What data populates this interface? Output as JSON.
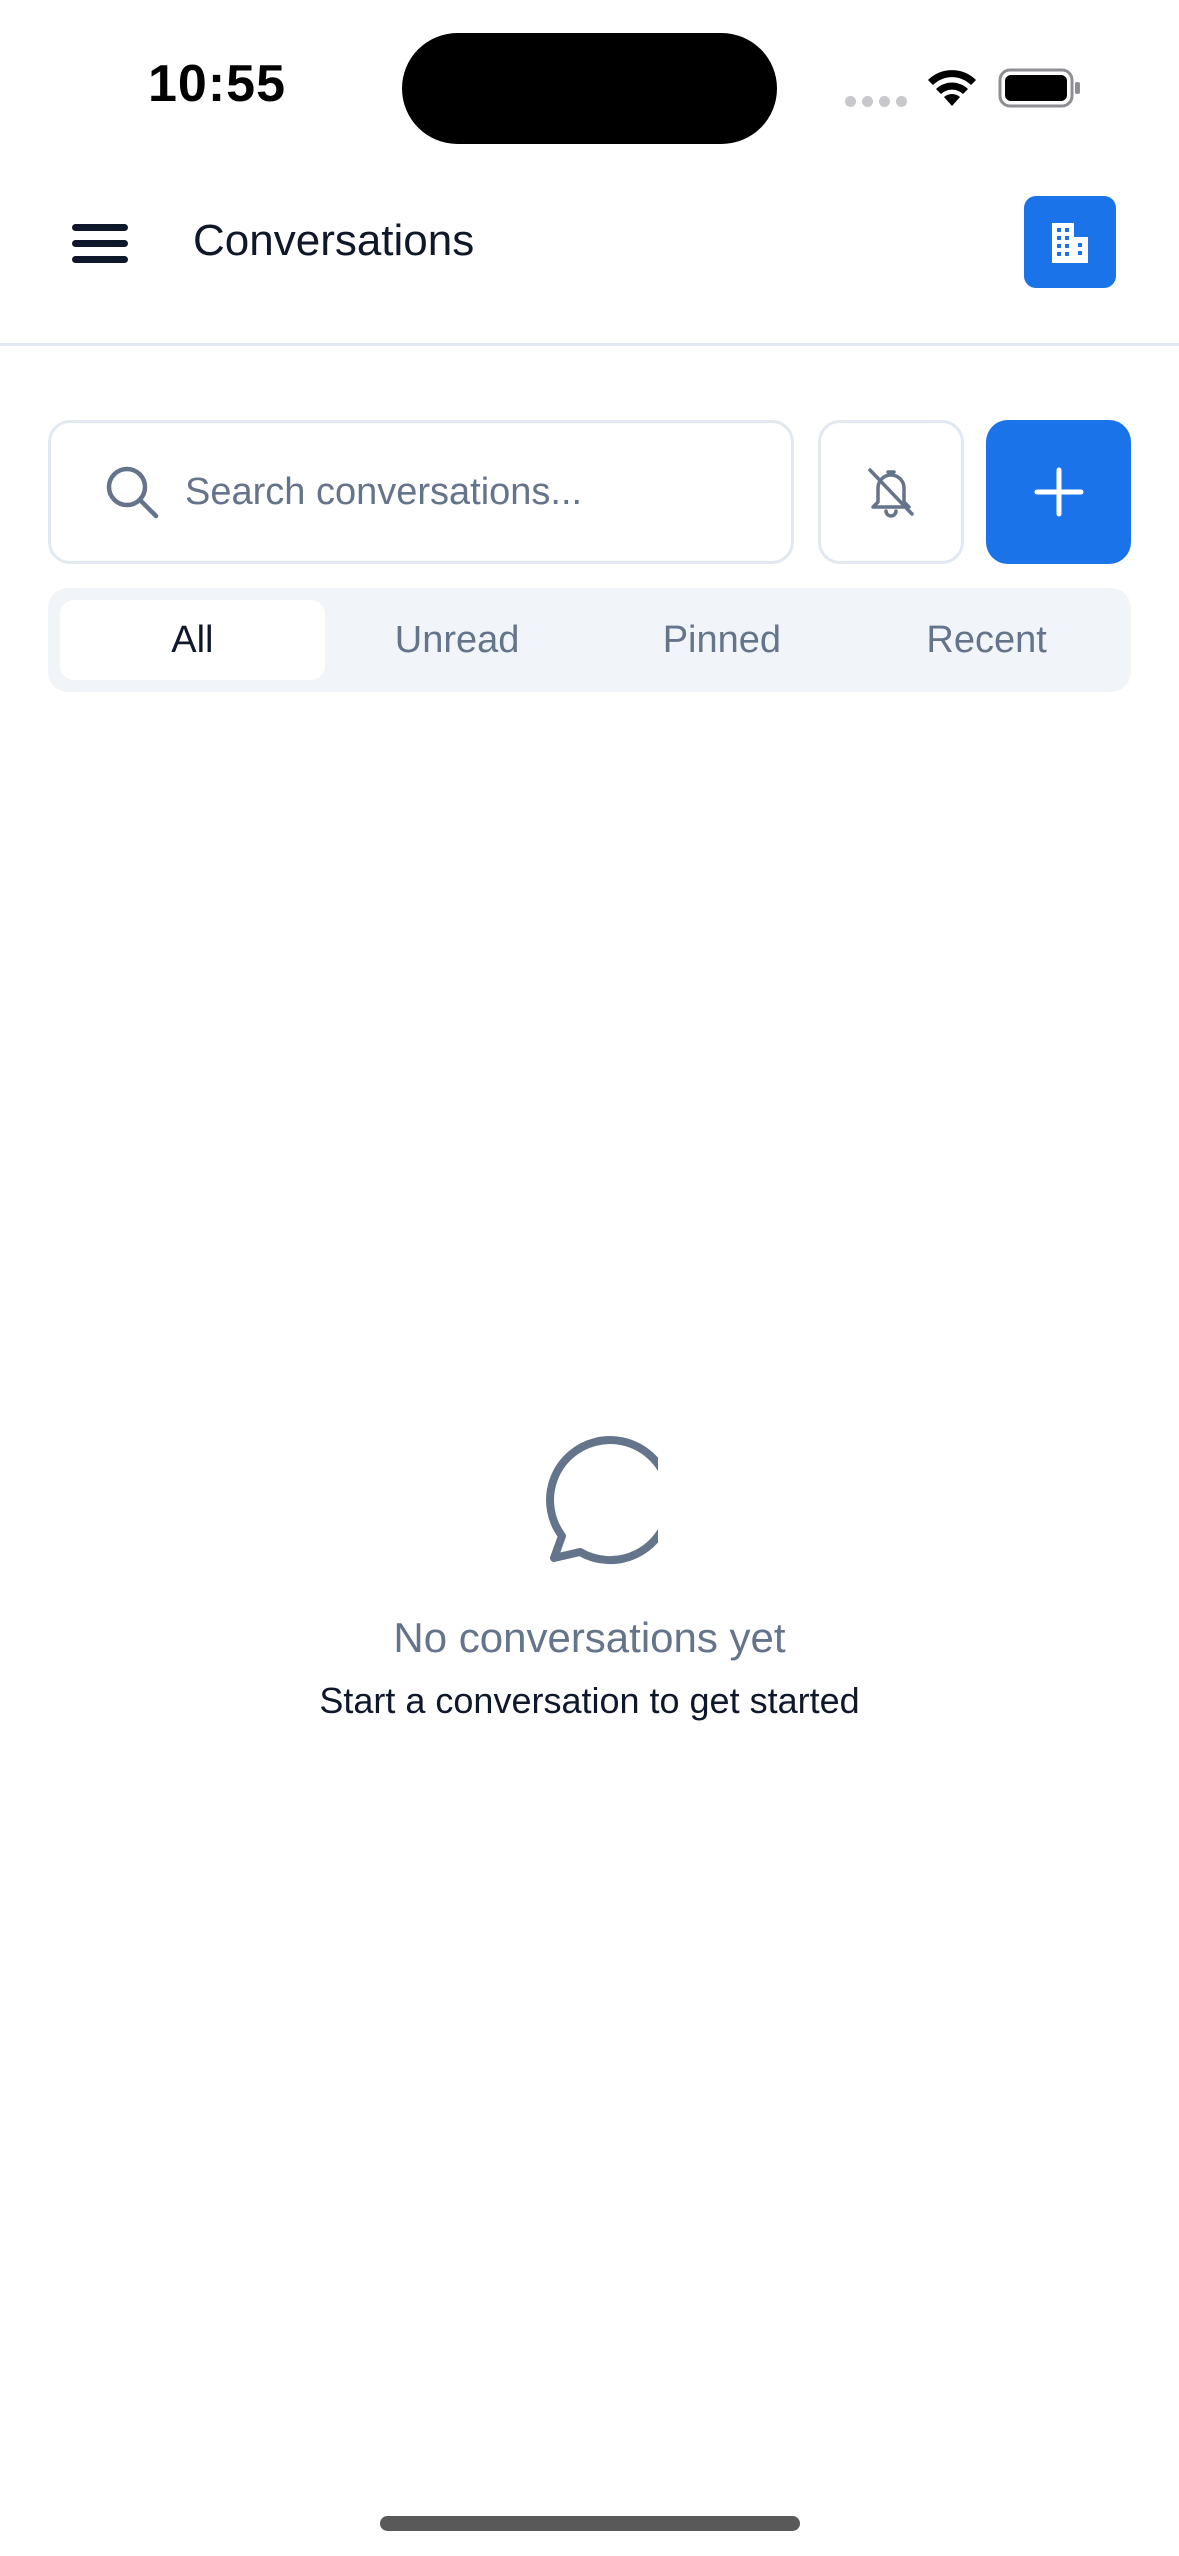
{
  "status_bar": {
    "time": "10:55"
  },
  "header": {
    "title": "Conversations",
    "menu_icon": "hamburger-menu-icon",
    "org_icon": "building-icon",
    "accent_color": "#1a73e8"
  },
  "search": {
    "placeholder": "Search conversations...",
    "value": "",
    "icon": "search-icon"
  },
  "actions": {
    "notifications_icon": "bell-off-icon",
    "add_icon": "plus-icon"
  },
  "filters": {
    "tabs": [
      {
        "label": "All",
        "active": true
      },
      {
        "label": "Unread",
        "active": false
      },
      {
        "label": "Pinned",
        "active": false
      },
      {
        "label": "Recent",
        "active": false
      }
    ]
  },
  "empty_state": {
    "icon": "chat-bubble-icon",
    "title": "No conversations yet",
    "subtitle": "Start a conversation to get started"
  }
}
